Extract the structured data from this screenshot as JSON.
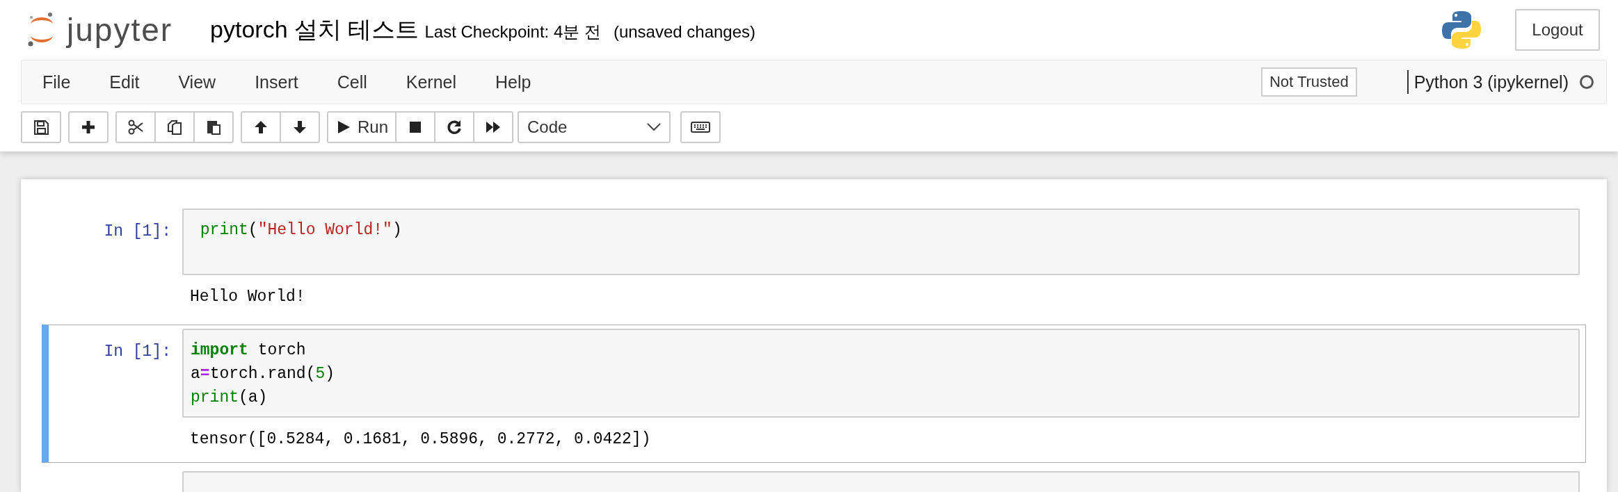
{
  "header": {
    "logo_text": "jupyter",
    "notebook_title": "pytorch 설치 테스트",
    "checkpoint": "Last Checkpoint: 4분 전",
    "autosave_status": "(unsaved changes)",
    "logout": "Logout"
  },
  "menu": [
    "File",
    "Edit",
    "View",
    "Insert",
    "Cell",
    "Kernel",
    "Help"
  ],
  "trust": "Not Trusted",
  "kernel": {
    "name": "Python 3 (ipykernel)",
    "busy": false
  },
  "toolbar": [
    [
      {
        "kind": "save"
      }
    ],
    [
      {
        "kind": "plus"
      }
    ],
    [
      {
        "kind": "cut"
      },
      {
        "kind": "copy"
      },
      {
        "kind": "paste"
      }
    ],
    [
      {
        "kind": "up"
      },
      {
        "kind": "down"
      }
    ],
    [
      {
        "kind": "run",
        "label": "Run"
      },
      {
        "kind": "stop"
      },
      {
        "kind": "restart"
      },
      {
        "kind": "forward"
      }
    ],
    [
      {
        "kind": "select",
        "value": "Code"
      }
    ],
    [
      {
        "kind": "keyboard"
      }
    ]
  ],
  "cells": [
    {
      "prompt": "In [1]:",
      "selected": false,
      "lines": [
        [
          {
            "kind": "builtin",
            "text": " print"
          },
          {
            "kind": "plain",
            "text": "("
          },
          {
            "kind": "string",
            "text": "\"Hello World!\""
          },
          {
            "kind": "plain",
            "text": ")"
          }
        ]
      ],
      "output": "Hello World!"
    },
    {
      "prompt": "In [1]:",
      "selected": true,
      "lines": [
        [
          {
            "kind": "keyword",
            "text": "import"
          },
          {
            "kind": "plain",
            "text": " torch"
          }
        ],
        [
          {
            "kind": "plain",
            "text": "a"
          },
          {
            "kind": "operator",
            "text": "="
          },
          {
            "kind": "plain",
            "text": "torch.rand("
          },
          {
            "kind": "number",
            "text": "5"
          },
          {
            "kind": "plain",
            "text": ")"
          }
        ],
        [
          {
            "kind": "builtin",
            "text": "print"
          },
          {
            "kind": "plain",
            "text": "(a)"
          }
        ]
      ],
      "output": "tensor([0.5284, 0.1681, 0.5896, 0.2772, 0.0422])"
    },
    {
      "selected": false
    }
  ]
}
